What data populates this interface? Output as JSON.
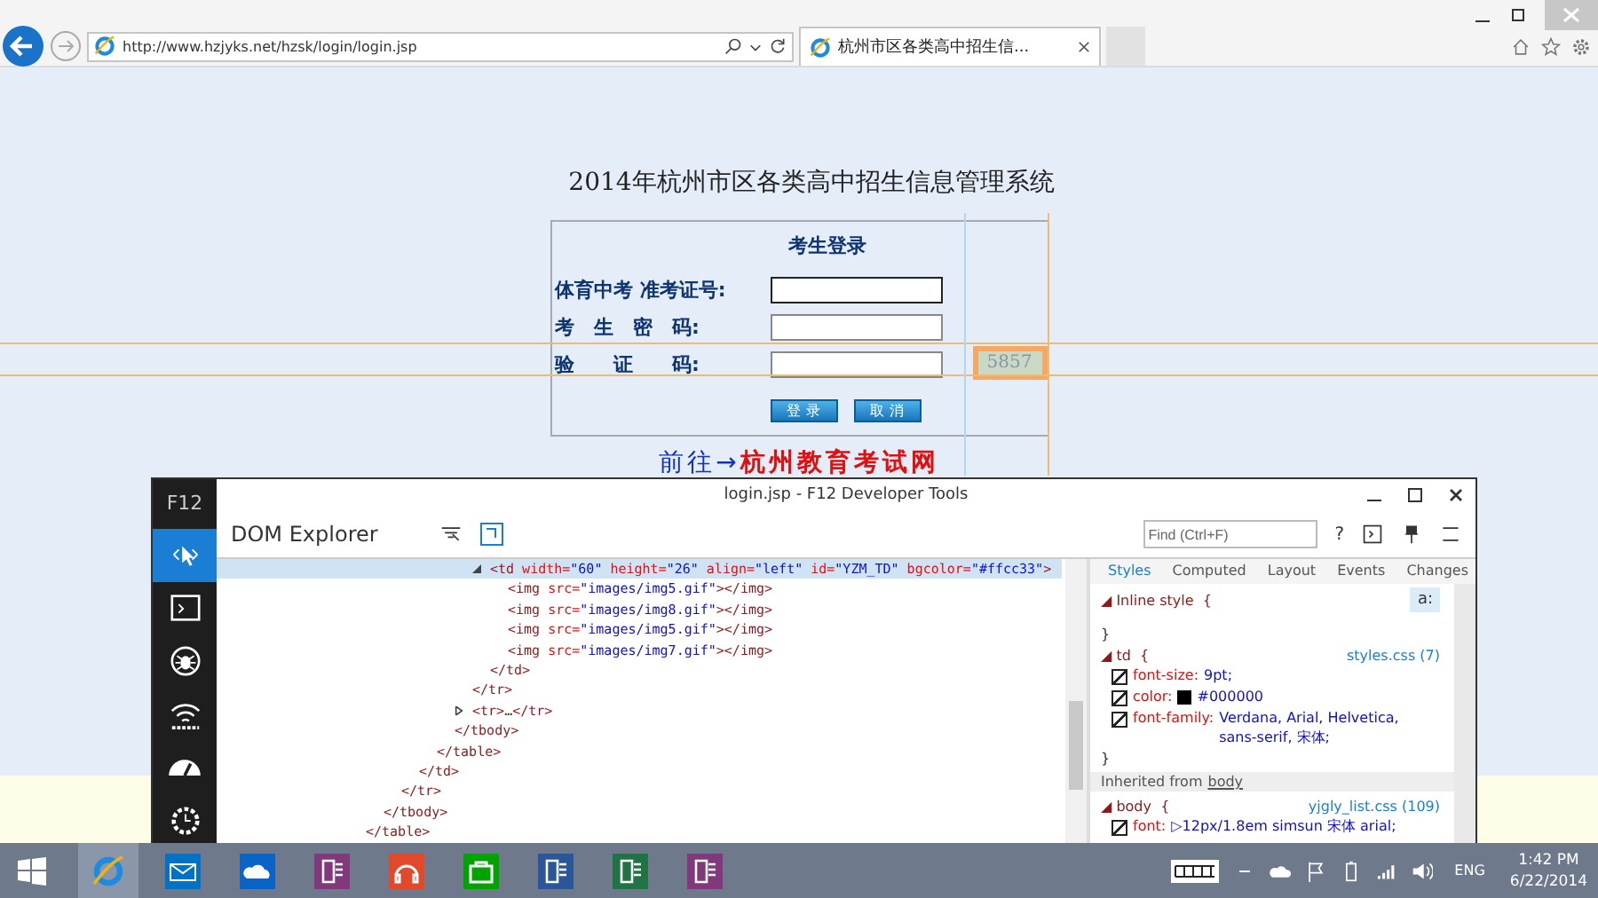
{
  "browser": {
    "address": "http://www.hzjyks.net/hzsk/login/login.jsp",
    "tab_title": "杭州市区各类高中招生信..."
  },
  "page": {
    "title": "2014年杭州市区各类高中招生信息管理系统",
    "login": {
      "heading": "考生登录",
      "fields": [
        {
          "label": "体育中考 准考证号:"
        },
        {
          "label": "考　生　密　码:"
        },
        {
          "label": "验　　证　　码:"
        }
      ],
      "captcha": "5857",
      "buttons": [
        "登 录",
        "取 消"
      ]
    },
    "link_prefix": "前往→",
    "link": "杭州教育考试网"
  },
  "devtools": {
    "window_title": "login.jsp - F12 Developer Tools",
    "tool_label": "F12",
    "panel": "DOM Explorer",
    "find_placeholder": "Find (Ctrl+F)",
    "help": "?",
    "tools": [
      {
        "kind": "dom",
        "selected": true
      },
      {
        "kind": "console",
        "selected": false
      },
      {
        "kind": "debugger",
        "selected": false
      },
      {
        "kind": "network",
        "selected": false
      },
      {
        "kind": "performance",
        "selected": false
      },
      {
        "kind": "memory",
        "selected": false
      }
    ],
    "dom_tree": [
      {
        "close": [
          {
            "t": "</table>",
            "kind": "tag"
          }
        ],
        "children": [
          {
            "close": [
              {
                "t": "</tbody>",
                "kind": "tag"
              }
            ],
            "children": [
              {
                "close": [
                  {
                    "t": "</tr>",
                    "kind": "tag"
                  }
                ],
                "children": [
                  {
                    "close": [
                      {
                        "t": "</td>",
                        "kind": "tag"
                      }
                    ],
                    "children": [
                      {
                        "close": [
                          {
                            "t": "</table>",
                            "kind": "tag"
                          }
                        ],
                        "children": [
                          {
                            "close": [
                              {
                                "t": "</tbody>",
                                "kind": "tag"
                              }
                            ],
                            "children": [
                              {
                                "close": [
                                  {
                                    "t": "</tr>",
                                    "kind": "tag"
                                  }
                                ],
                                "children": [
                                  {
                                    "selected": true,
                                    "expanded": true,
                                    "open": [
                                      {
                                        "t": "<td",
                                        "kind": "tag"
                                      },
                                      {
                                        "t": " width=",
                                        "kind": "attr"
                                      },
                                      {
                                        "t": "\"60\"",
                                        "kind": "value"
                                      },
                                      {
                                        "t": " height=",
                                        "kind": "attr"
                                      },
                                      {
                                        "t": "\"26\"",
                                        "kind": "value"
                                      },
                                      {
                                        "t": " align=",
                                        "kind": "attr"
                                      },
                                      {
                                        "t": "\"left\"",
                                        "kind": "value"
                                      },
                                      {
                                        "t": " id=",
                                        "kind": "attr"
                                      },
                                      {
                                        "t": "\"YZM_TD\"",
                                        "kind": "value"
                                      },
                                      {
                                        "t": " bgcolor=",
                                        "kind": "attr"
                                      },
                                      {
                                        "t": "\"#ffcc33\"",
                                        "kind": "value"
                                      },
                                      {
                                        "t": ">",
                                        "kind": "tag"
                                      }
                                    ],
                                    "close": [
                                      {
                                        "t": "</td>",
                                        "kind": "tag"
                                      }
                                    ],
                                    "children": [
                                      {
                                        "open": [
                                          {
                                            "t": "<img",
                                            "kind": "tag"
                                          },
                                          {
                                            "t": " src=",
                                            "kind": "attr"
                                          },
                                          {
                                            "t": "\"images/img5.gif\"",
                                            "kind": "value"
                                          },
                                          {
                                            "t": "></img>",
                                            "kind": "tag"
                                          }
                                        ]
                                      },
                                      {
                                        "open": [
                                          {
                                            "t": "<img",
                                            "kind": "tag"
                                          },
                                          {
                                            "t": " src=",
                                            "kind": "attr"
                                          },
                                          {
                                            "t": "\"images/img8.gif\"",
                                            "kind": "value"
                                          },
                                          {
                                            "t": "></img>",
                                            "kind": "tag"
                                          }
                                        ]
                                      },
                                      {
                                        "open": [
                                          {
                                            "t": "<img",
                                            "kind": "tag"
                                          },
                                          {
                                            "t": " src=",
                                            "kind": "attr"
                                          },
                                          {
                                            "t": "\"images/img5.gif\"",
                                            "kind": "value"
                                          },
                                          {
                                            "t": "></img>",
                                            "kind": "tag"
                                          }
                                        ]
                                      },
                                      {
                                        "open": [
                                          {
                                            "t": "<img",
                                            "kind": "tag"
                                          },
                                          {
                                            "t": " src=",
                                            "kind": "attr"
                                          },
                                          {
                                            "t": "\"images/img7.gif\"",
                                            "kind": "value"
                                          },
                                          {
                                            "t": "></img>",
                                            "kind": "tag"
                                          }
                                        ]
                                      }
                                    ]
                                  }
                                ]
                              },
                              {
                                "expanded": false,
                                "open": [
                                  {
                                    "t": "<tr>",
                                    "kind": "tag"
                                  },
                                  {
                                    "t": "…",
                                    "kind": "punct"
                                  },
                                  {
                                    "t": "</tr>",
                                    "kind": "tag"
                                  }
                                ]
                              }
                            ]
                          }
                        ]
                      }
                    ]
                  }
                ]
              }
            ]
          }
        ]
      }
    ],
    "style_tabs": [
      {
        "label": "Styles",
        "selected": true
      },
      {
        "label": "Computed",
        "selected": false
      },
      {
        "label": "Layout",
        "selected": false
      },
      {
        "label": "Events",
        "selected": false
      },
      {
        "label": "Changes",
        "selected": false
      }
    ],
    "pseudo_toggle": "a:",
    "inline_style": {
      "open": "◢ Inline style  {",
      "close": "}"
    },
    "rules": [
      {
        "selector": "◢ td  {",
        "source": "styles.css (7)",
        "close": "}",
        "props": [
          {
            "name": "font-size:",
            "value": "9pt;",
            "checked": true
          },
          {
            "name": "color:",
            "value": "#000000",
            "checked": true,
            "swatch": true
          },
          {
            "name": "font-family:",
            "value": "Verdana, Arial, Helvetica, sans-serif, 宋体;",
            "checked": true
          }
        ]
      }
    ],
    "inherited_label": "Inherited from",
    "inherited_from": "body",
    "inherited_rules": [
      {
        "selector": "◢ body  {",
        "source": "yjgly_list.css (109)",
        "props": [
          {
            "name": "font:",
            "value": "▷12px/1.8em simsun 宋体 arial;",
            "checked": true
          }
        ]
      }
    ]
  },
  "taskbar": {
    "apps": [
      {
        "kind": "browser",
        "active": true
      },
      {
        "kind": "mail",
        "active": false
      },
      {
        "kind": "cloud",
        "active": false
      },
      {
        "kind": "notebook",
        "active": false
      },
      {
        "kind": "music",
        "active": false
      },
      {
        "kind": "store",
        "active": false
      },
      {
        "kind": "document",
        "active": false
      },
      {
        "kind": "spreadsheet",
        "active": false
      },
      {
        "kind": "notebook",
        "active": false
      }
    ],
    "language": "ENG",
    "time": "1:42 PM",
    "date": "6/22/2014"
  }
}
